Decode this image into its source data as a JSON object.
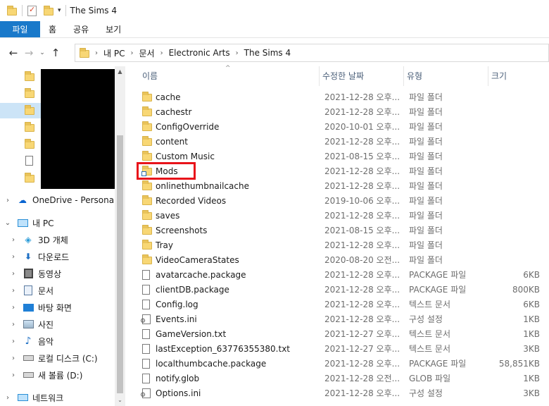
{
  "window": {
    "title": "The Sims 4"
  },
  "ribbon": {
    "tabs": [
      "파일",
      "홈",
      "공유",
      "보기"
    ]
  },
  "address": {
    "crumbs": [
      "내 PC",
      "문서",
      "Electronic Arts",
      "The Sims 4"
    ]
  },
  "nav": {
    "onedrive": "OneDrive - Personal",
    "thispc": "내 PC",
    "items": [
      "3D 개체",
      "다운로드",
      "동영상",
      "문서",
      "바탕 화면",
      "사진",
      "음악",
      "로컬 디스크 (C:)",
      "새 볼륨 (D:)"
    ],
    "network": "네트워크"
  },
  "columns": {
    "name": "이름",
    "date": "수정한 날짜",
    "type": "유형",
    "size": "크기"
  },
  "files": [
    {
      "name": "cache",
      "date": "2021-12-28 오후...",
      "type": "파일 폴더",
      "size": "",
      "kind": "folder"
    },
    {
      "name": "cachestr",
      "date": "2021-12-28 오후...",
      "type": "파일 폴더",
      "size": "",
      "kind": "folder"
    },
    {
      "name": "ConfigOverride",
      "date": "2020-10-01 오후...",
      "type": "파일 폴더",
      "size": "",
      "kind": "folder"
    },
    {
      "name": "content",
      "date": "2021-12-28 오후...",
      "type": "파일 폴더",
      "size": "",
      "kind": "folder"
    },
    {
      "name": "Custom Music",
      "date": "2021-08-15 오후...",
      "type": "파일 폴더",
      "size": "",
      "kind": "folder"
    },
    {
      "name": "Mods",
      "date": "2021-12-28 오후...",
      "type": "파일 폴더",
      "size": "",
      "kind": "mods"
    },
    {
      "name": "onlinethumbnailcache",
      "date": "2021-12-28 오후...",
      "type": "파일 폴더",
      "size": "",
      "kind": "folder"
    },
    {
      "name": "Recorded Videos",
      "date": "2019-10-06 오후...",
      "type": "파일 폴더",
      "size": "",
      "kind": "folder"
    },
    {
      "name": "saves",
      "date": "2021-12-28 오후...",
      "type": "파일 폴더",
      "size": "",
      "kind": "folder"
    },
    {
      "name": "Screenshots",
      "date": "2021-08-15 오후...",
      "type": "파일 폴더",
      "size": "",
      "kind": "folder"
    },
    {
      "name": "Tray",
      "date": "2021-12-28 오후...",
      "type": "파일 폴더",
      "size": "",
      "kind": "folder"
    },
    {
      "name": "VideoCameraStates",
      "date": "2020-08-20 오전...",
      "type": "파일 폴더",
      "size": "",
      "kind": "folder"
    },
    {
      "name": "avatarcache.package",
      "date": "2021-12-28 오후...",
      "type": "PACKAGE 파일",
      "size": "6KB",
      "kind": "doc"
    },
    {
      "name": "clientDB.package",
      "date": "2021-12-28 오후...",
      "type": "PACKAGE 파일",
      "size": "800KB",
      "kind": "doc"
    },
    {
      "name": "Config.log",
      "date": "2021-12-28 오후...",
      "type": "텍스트 문서",
      "size": "6KB",
      "kind": "doc"
    },
    {
      "name": "Events.ini",
      "date": "2021-12-28 오후...",
      "type": "구성 설정",
      "size": "1KB",
      "kind": "cfg"
    },
    {
      "name": "GameVersion.txt",
      "date": "2021-12-27 오후...",
      "type": "텍스트 문서",
      "size": "1KB",
      "kind": "doc"
    },
    {
      "name": "lastException_63776355380.txt",
      "date": "2021-12-27 오후...",
      "type": "텍스트 문서",
      "size": "3KB",
      "kind": "doc"
    },
    {
      "name": "localthumbcache.package",
      "date": "2021-12-28 오후...",
      "type": "PACKAGE 파일",
      "size": "58,851KB",
      "kind": "doc"
    },
    {
      "name": "notify.glob",
      "date": "2021-12-28 오전...",
      "type": "GLOB 파일",
      "size": "1KB",
      "kind": "doc"
    },
    {
      "name": "Options.ini",
      "date": "2021-12-28 오후...",
      "type": "구성 설정",
      "size": "3KB",
      "kind": "cfg"
    }
  ],
  "colors": {
    "file_tab": "#1979ca",
    "folder": "#f8d775",
    "highlight": "#e8131a",
    "selected_nav": "#cce4f7"
  },
  "icons": [
    "folder-icon",
    "properties-icon",
    "back-arrow-icon",
    "forward-arrow-icon",
    "up-arrow-icon",
    "onedrive-icon",
    "pc-icon",
    "document-icon",
    "settings-file-icon"
  ]
}
